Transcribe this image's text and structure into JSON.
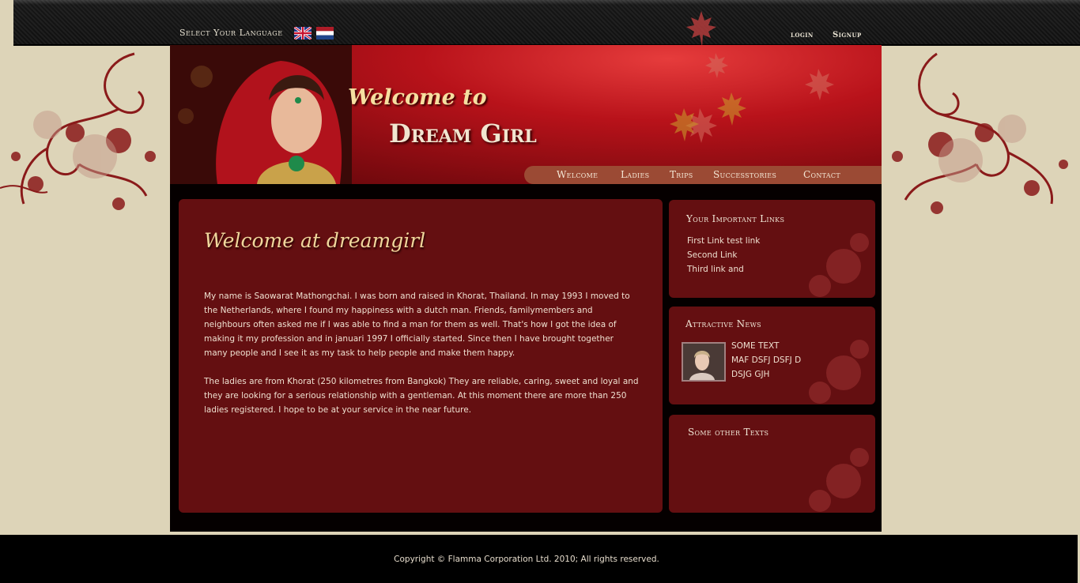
{
  "topbar": {
    "language_label": "Select Your Language",
    "login": "login",
    "signup": "Signup"
  },
  "header": {
    "welcome_to": "Welcome to",
    "site_name": "Dream Girl"
  },
  "nav": {
    "items": [
      "Welcome",
      "Ladies",
      "Trips",
      "Successtories",
      "Contact"
    ]
  },
  "main": {
    "title": "Welcome at dreamgirl",
    "paragraphs": [
      "My name is Saowarat Mathongchai. I was born and raised in Khorat, Thailand. In may 1993 I moved to the Netherlands, where I found my happiness with a dutch man. Friends, familymembers and neighbours often asked me if I was able to find a man for them as well. That's how I got the idea of making it my profession and in januari 1997 I officially started. Since then I have brought together many people and I see it as my task to help people and make them happy.",
      "The ladies are from Khorat (250 kilometres from Bangkok) They are reliable, caring, sweet and loyal and they are looking for a serious relationship with a gentleman. At this moment there are more than 250 ladies registered. I hope to be at your service in the near future."
    ]
  },
  "sidebar": {
    "links_title": "Your Important Links",
    "links": [
      "First Link test link",
      "Second Link",
      "Third link and"
    ],
    "news_title": "Attractive News",
    "news_lines": [
      "SOME TEXT",
      "MAF DSFJ DSFJ D",
      "DSJG GJH"
    ],
    "other_title": "Some other Texts"
  },
  "footer": {
    "copyright": "Copyright © Flamma Corporation Ltd. 2010; All rights reserved."
  },
  "colors": {
    "page_bg": "#ddd4b8",
    "panel": "#640f11",
    "banner_red": "#b8121a",
    "nav_bar": "#9b4a34",
    "title_gold": "#f0d79c"
  }
}
